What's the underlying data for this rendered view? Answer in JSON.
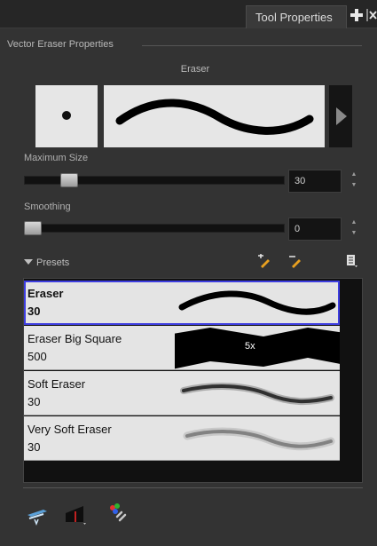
{
  "window": {
    "tab_title": "Tool Properties",
    "section_title": "Vector Eraser Properties"
  },
  "preview": {
    "caption": "Eraser"
  },
  "max_size": {
    "label": "Maximum Size",
    "value": "30",
    "slider_fraction": 0.15
  },
  "smoothing": {
    "label": "Smoothing",
    "value": "0",
    "slider_fraction": 0.0
  },
  "presets": {
    "label": "Presets",
    "items": [
      {
        "name": "Eraser",
        "size": "30",
        "selected": true
      },
      {
        "name": "Eraser Big Square",
        "size": "500",
        "badge": "5x"
      },
      {
        "name": "Soft Eraser",
        "size": "30"
      },
      {
        "name": "Very Soft Eraser",
        "size": "30"
      }
    ]
  },
  "icons": {
    "tab_add": "plus-icon",
    "tab_close": "close-icon",
    "preset_new": "new-preset-icon",
    "preset_delete": "delete-preset-icon",
    "preset_menu": "preset-menu-icon",
    "bottom": [
      "flatten-icon",
      "texture-icon",
      "color-link-icon"
    ]
  },
  "colors": {
    "selection_outline": "#3d3de0",
    "preset_background": "#e4e4e4",
    "panel_background": "#333333"
  }
}
